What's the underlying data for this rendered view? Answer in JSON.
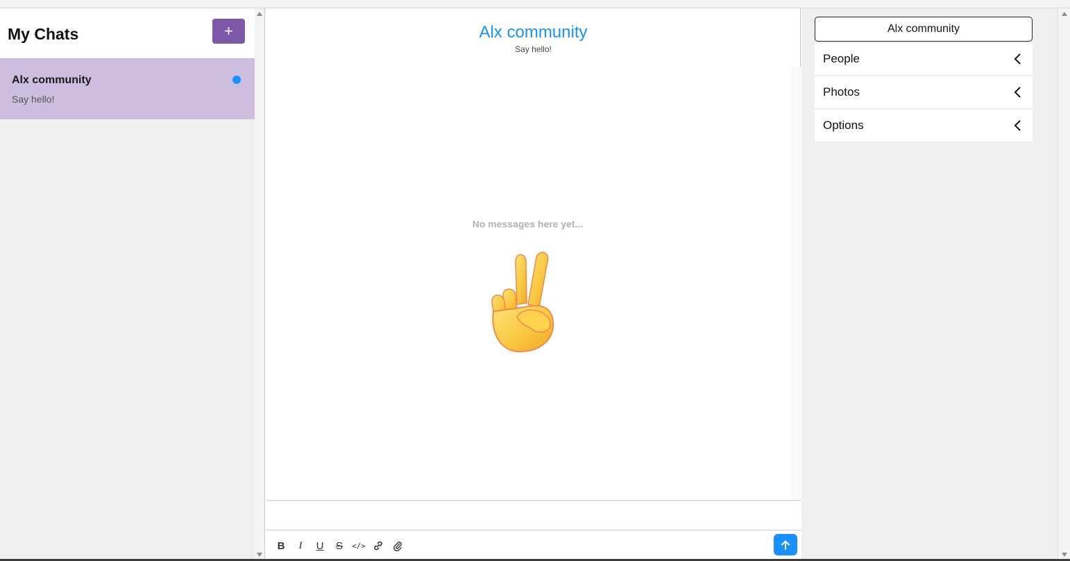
{
  "left": {
    "title": "My Chats",
    "new_chat_label": "+",
    "chats": [
      {
        "title": "Alx community",
        "last_message": "Say hello!",
        "unread": true
      }
    ]
  },
  "center": {
    "title": "Alx community",
    "subtitle": "Say hello!",
    "empty_text": "No messages here yet...",
    "composer_value": ""
  },
  "toolbar": {
    "items": [
      "bold-icon",
      "italic-icon",
      "underline-icon",
      "strikethrough-icon",
      "code-icon",
      "link-icon",
      "attachment-icon"
    ],
    "send_icon": "arrow-up-icon"
  },
  "right": {
    "title": "Alx community",
    "sections": [
      "People",
      "Photos",
      "Options"
    ],
    "chevron_icon": "chevron-left-icon"
  },
  "colors": {
    "accent": "#1890ff",
    "brand_purple": "#7e57a8",
    "selected_chat": "#cdbddf"
  }
}
